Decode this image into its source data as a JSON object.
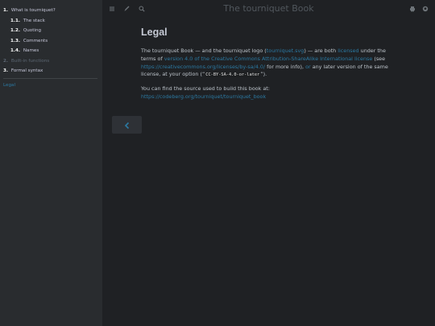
{
  "menu": {
    "title": "The tourniquet Book"
  },
  "toc": [
    {
      "num": "1.",
      "label": "What is tourniquet?",
      "level": 0,
      "draft": false
    },
    {
      "num": "1.1.",
      "label": "The stack",
      "level": 1,
      "draft": false
    },
    {
      "num": "1.2.",
      "label": "Quoting",
      "level": 1,
      "draft": false
    },
    {
      "num": "1.3.",
      "label": "Comments",
      "level": 1,
      "draft": false
    },
    {
      "num": "1.4.",
      "label": "Names",
      "level": 1,
      "draft": false
    },
    {
      "num": "2.",
      "label": "Built-in functions",
      "level": 0,
      "draft": true
    },
    {
      "num": "3.",
      "label": "Formal syntax",
      "level": 0,
      "draft": false
    }
  ],
  "toc_suffix": {
    "label": "Legal"
  },
  "page": {
    "heading": "Legal",
    "p1": {
      "t1": "The tourniquet Book — and the tourniquet logo (",
      "link_logo": "tourniquet.svg",
      "t2": ") — are both ",
      "link_licensed": "licensed",
      "t3": " under the terms of ",
      "link_cc": "version 4.0 of the Creative Commons Attribution-ShareAlike International license",
      "t4": " (see ",
      "link_url": "https://creativecommons.org/licenses/by-sa/4.0/",
      "t5": " for more info), ",
      "link_or": "or",
      "t6": " any later version of the same license, at your option (“",
      "code": "CC-BY-SA-4.0-or-later",
      "t7": "”)."
    },
    "p2": {
      "text": "You can find the source used to build this book at:",
      "link": "https://codeberg.org/tourniquet/tourniquet_book"
    }
  },
  "icons": {
    "menu": "hamburger-icon",
    "theme": "paintbrush-icon",
    "search": "search-icon",
    "print": "print-icon",
    "repo": "git-repository-icon",
    "prev": "chevron-left-icon"
  },
  "colors": {
    "sidebar_bg": "#292c2f",
    "page_bg": "#1f2124",
    "link": "#2b79a2",
    "text": "#bcc3ca"
  }
}
